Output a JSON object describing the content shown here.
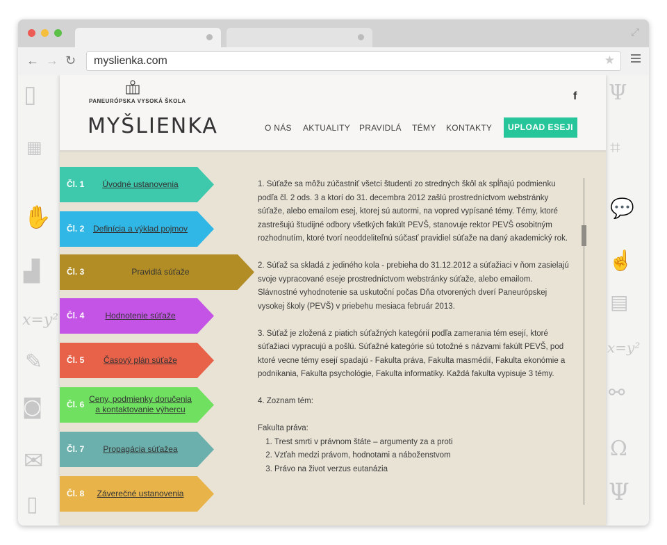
{
  "browser": {
    "url": "myslienka.com"
  },
  "header": {
    "university": "Paneurópska vysoká škola",
    "title": "MYŠLIENKA",
    "facebook": "f",
    "nav": [
      "O NÁS",
      "AKTUALITY",
      "PRAVIDLÁ",
      "TÉMY",
      "KONTAKTY"
    ],
    "upload": "UPLOAD ESEJI"
  },
  "sections": [
    {
      "num": "Čl. 1",
      "label": "Úvodné ustanovenia",
      "color": "#3ec9ad"
    },
    {
      "num": "Čl. 2",
      "label": "Definícia a výklad pojmov",
      "color": "#31b7e6"
    },
    {
      "num": "Čl. 3",
      "label": "Pravidlá súťaže",
      "color": "#b28d26",
      "active": true
    },
    {
      "num": "Čl. 4",
      "label": "Hodnotenie súťaže",
      "color": "#c454e6"
    },
    {
      "num": "Čl. 5",
      "label": "Časový plán súťaže",
      "color": "#e8624a"
    },
    {
      "num": "Čl. 6",
      "label": "Ceny, podmienky doručenia a kontaktovanie výhercu",
      "color": "#6fe060"
    },
    {
      "num": "Čl. 7",
      "label": "Propagácia súťažea",
      "color": "#6cb0ad"
    },
    {
      "num": "Čl. 8",
      "label": "Záverečné ustanovenia",
      "color": "#e8b44a"
    }
  ],
  "content": {
    "p1": "1. Súťaže sa môžu zúčastniť všetci študenti zo stredných škôl ak spĺňajú podmienku podľa čl. 2 ods. 3 a ktorí do 31. decembra 2012 zašlú prostredníctvom webstránky súťaže, alebo emailom esej, ktorej sú autormi, na vopred vypísané témy. Témy, ktoré zastrešujú študijné odbory všetkých fakúlt PEVŠ, stanovuje rektor PEVŠ osobitným rozhodnutím, ktoré tvorí neoddeliteľnú súčasť pravidiel súťaže na daný akademický rok.",
    "p2": "2. Súťaž sa skladá z jediného kola - prebieha do 31.12.2012 a súťažiaci v ňom zasielajú svoje vypracované eseje prostredníctvom webstránky súťaže, alebo emailom. Slávnostné vyhodnotenie sa uskutoční počas Dňa otvorených dverí Paneurópskej vysokej školy (PEVŠ) v priebehu mesiaca február 2013.",
    "p3": "3. Súťaž je zložená z piatich súťažných kategórií podľa zamerania tém esejí, ktoré súťažiaci vypracujú a pošlú. Súťažné kategórie sú totožné s názvami fakúlt PEVŠ, pod ktoré vecne témy esejí spadajú - Fakulta práva, Fakulta masmédií, Fakulta ekonómie a podnikania, Fakulta psychológie, Fakulta informatiky. Každá fakulta vypisuje 3 témy.",
    "p4": "4. Zoznam tém:",
    "faculty": "Fakulta práva:",
    "topics": [
      "Trest smrti v právnom štáte – argumenty za a proti",
      "Vzťah medzi právom, hodnotami a náboženstvom",
      "Právo na život verzus eutanázia"
    ]
  }
}
